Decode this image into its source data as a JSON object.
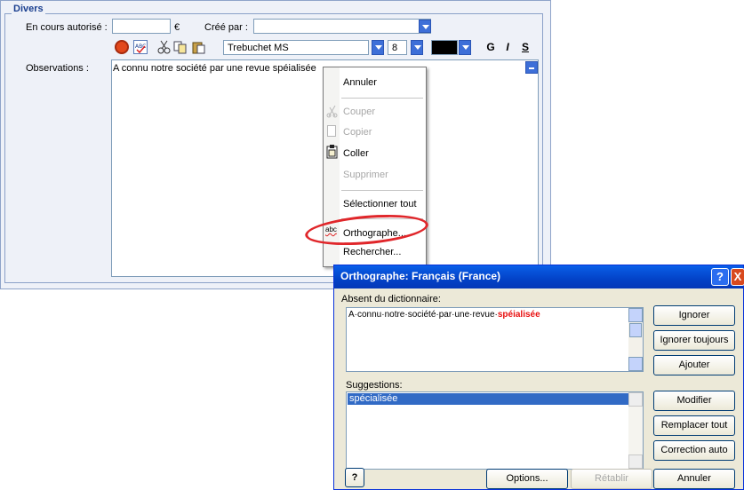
{
  "form": {
    "legend": "Divers",
    "en_cours_label": "En cours autorisé :",
    "currency_symbol": "€",
    "cree_par_label": "Créé par :",
    "font_name": "Trebuchet MS",
    "font_size": "8",
    "bold_label": "G",
    "italic_label": "I",
    "underline_label": "S",
    "observations_label": "Observations :",
    "observations_text": "A connu notre société par une revue spéialisée "
  },
  "context_menu": {
    "items": [
      {
        "label": "Annuler",
        "enabled": true
      },
      {
        "label": "Couper",
        "enabled": false,
        "icon": "scissors-icon"
      },
      {
        "label": "Copier",
        "enabled": false,
        "icon": "copy-icon"
      },
      {
        "label": "Coller",
        "enabled": true,
        "icon": "clipboard-icon"
      },
      {
        "label": "Supprimer",
        "enabled": false
      },
      {
        "label": "Sélectionner tout",
        "enabled": true
      },
      {
        "label": "Orthographe...",
        "enabled": true,
        "icon": "abc-spelling-icon"
      },
      {
        "label": "Rechercher...",
        "enabled": true
      }
    ]
  },
  "dialog": {
    "title": "Orthographe: Français (France)",
    "absent_label": "Absent du dictionnaire:",
    "text_normal": "A·connu·notre·société·par·une·revue·",
    "text_error": "spéialisée",
    "suggestions_label": "Suggestions:",
    "suggestions": [
      "spécialisée"
    ],
    "buttons": {
      "ignorer": "Ignorer",
      "ignorer_toujours": "Ignorer toujours",
      "ajouter": "Ajouter",
      "modifier": "Modifier",
      "remplacer_tout": "Remplacer tout",
      "correction_auto": "Correction auto",
      "options": "Options...",
      "retablir": "Rétablir",
      "annuler": "Annuler"
    },
    "help_glyph": "?",
    "close_glyph": "X"
  },
  "colors": {
    "highlight_circle": "#e0262a",
    "error_text": "#e81010",
    "selection": "#316ac5",
    "titlebar": "#0a5fe8"
  }
}
